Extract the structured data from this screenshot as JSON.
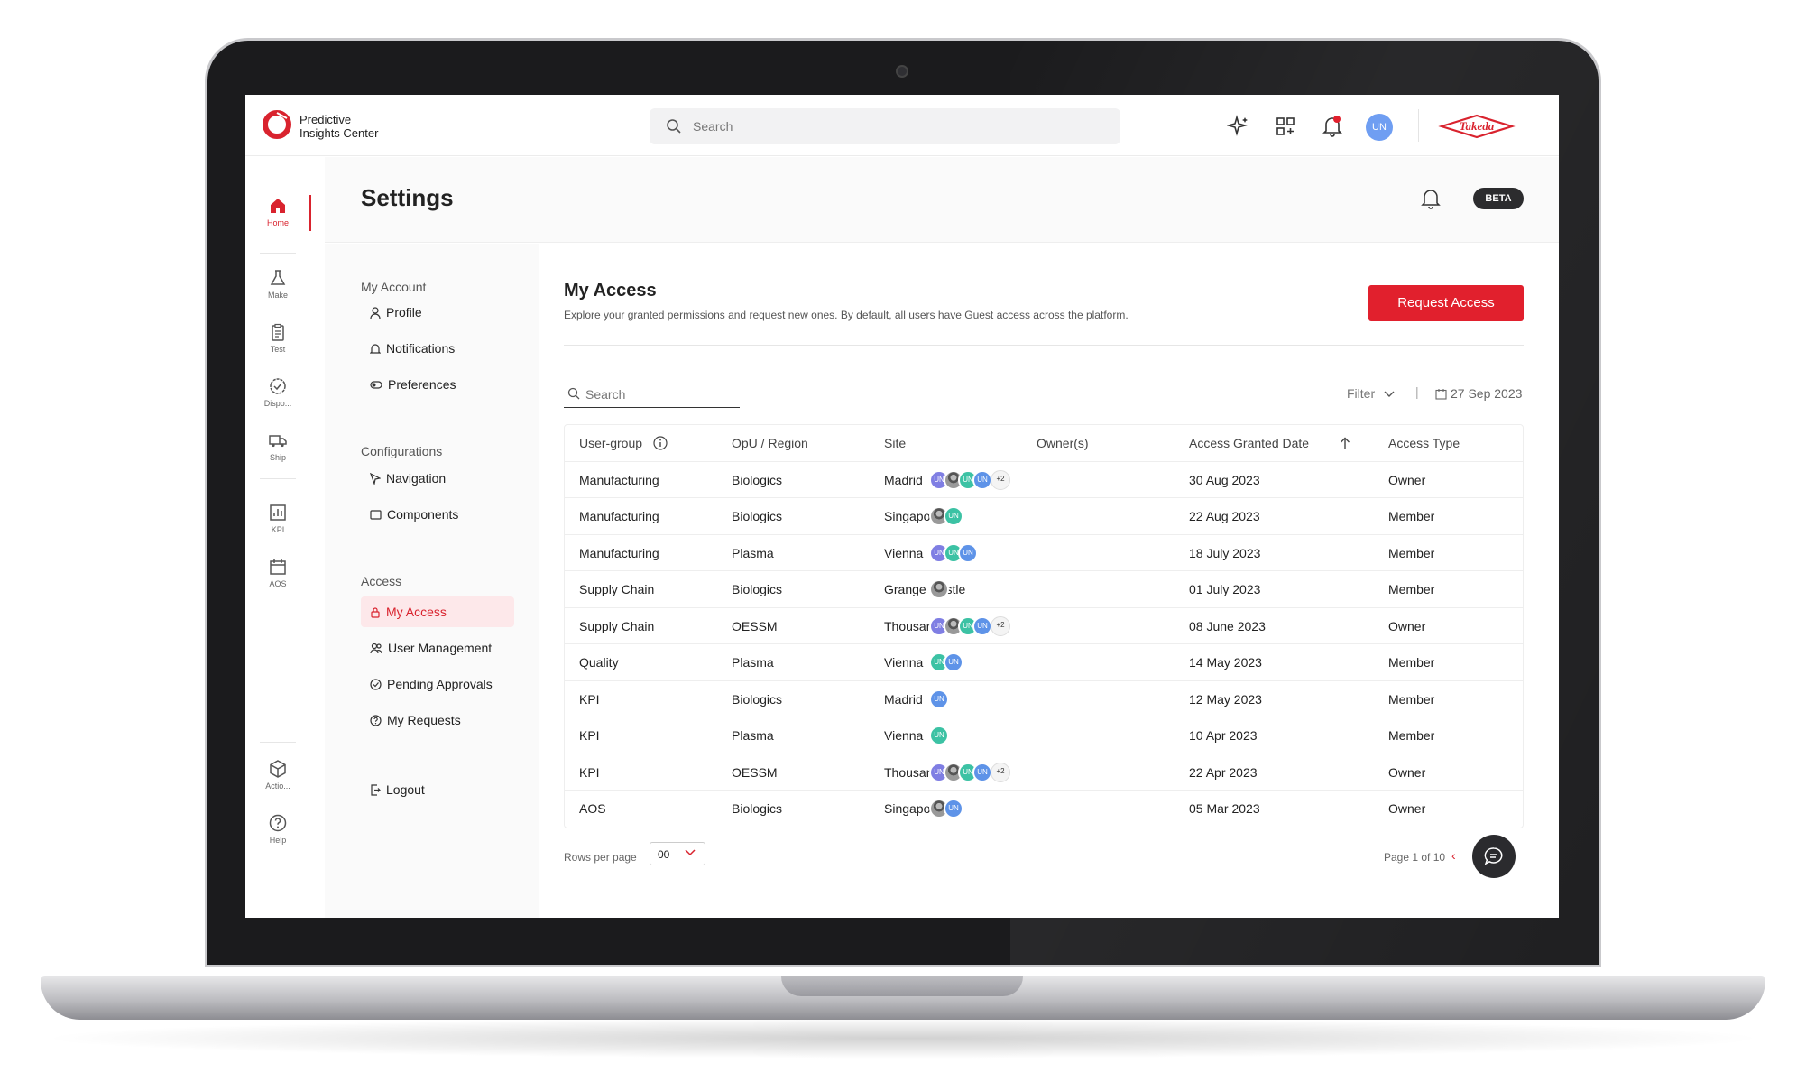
{
  "app": {
    "brand_line1": "Predictive",
    "brand_line2": "Insights Center",
    "search_placeholder": "Search",
    "avatar": "UN",
    "partner_logo": "Takeda"
  },
  "rail": [
    {
      "label": "Home",
      "icon": "home-icon",
      "active": true
    },
    {
      "label": "Make",
      "icon": "flask-icon"
    },
    {
      "label": "Test",
      "icon": "clipboard-icon"
    },
    {
      "label": "Dispo...",
      "icon": "check-badge-icon"
    },
    {
      "label": "Ship",
      "icon": "truck-icon"
    },
    {
      "label": "KPI",
      "icon": "bar-chart-icon"
    },
    {
      "label": "AOS",
      "icon": "calendar-icon"
    },
    {
      "label": "Actio...",
      "icon": "cube-icon"
    },
    {
      "label": "Help",
      "icon": "help-icon"
    }
  ],
  "settings": {
    "title": "Settings",
    "badge": "BETA"
  },
  "nav": {
    "groups": {
      "account": "My Account",
      "config": "Configurations",
      "access": "Access"
    },
    "items": {
      "profile": "Profile",
      "notifications": "Notifications",
      "preferences": "Preferences",
      "navigation": "Navigation",
      "components": "Components",
      "my_access": "My Access",
      "user_management": "User Management",
      "pending": "Pending Approvals",
      "my_requests": "My Requests",
      "logout": "Logout"
    }
  },
  "main": {
    "title": "My Access",
    "subtitle": "Explore your granted permissions and request new ones. By default, all users have Guest access across the platform.",
    "request_button": "Request Access",
    "search_placeholder": "Search",
    "filter": "Filter",
    "date": "27 Sep 2023"
  },
  "table": {
    "headers": {
      "group": "User-group",
      "opu": "OpU / Region",
      "site": "Site",
      "owners": "Owner(s)",
      "date": "Access Granted Date",
      "type": "Access Type"
    },
    "rows": [
      {
        "group": "Manufacturing",
        "opu": "Biologics",
        "site": "Madrid",
        "owners": [
          "p",
          "ph",
          "t",
          "b"
        ],
        "more": "+2",
        "date": "30 Aug 2023",
        "type": "Owner"
      },
      {
        "group": "Manufacturing",
        "opu": "Biologics",
        "site": "Singapore",
        "owners": [
          "ph",
          "t"
        ],
        "more": "",
        "date": "22 Aug 2023",
        "type": "Member"
      },
      {
        "group": "Manufacturing",
        "opu": "Plasma",
        "site": "Vienna",
        "owners": [
          "p",
          "t",
          "b"
        ],
        "more": "",
        "date": "18 July 2023",
        "type": "Member"
      },
      {
        "group": "Supply Chain",
        "opu": "Biologics",
        "site": "Grange Castle",
        "owners": [
          "ph"
        ],
        "more": "",
        "date": "01 July 2023",
        "type": "Member"
      },
      {
        "group": "Supply Chain",
        "opu": "OESSM",
        "site": "Thousand Oaks",
        "owners": [
          "p",
          "ph",
          "t",
          "b"
        ],
        "more": "+2",
        "date": "08 June 2023",
        "type": "Owner"
      },
      {
        "group": "Quality",
        "opu": "Plasma",
        "site": "Vienna",
        "owners": [
          "t",
          "b"
        ],
        "more": "",
        "date": "14 May 2023",
        "type": "Member"
      },
      {
        "group": "KPI",
        "opu": "Biologics",
        "site": "Madrid",
        "owners": [
          "b"
        ],
        "more": "",
        "date": "12 May 2023",
        "type": "Member"
      },
      {
        "group": "KPI",
        "opu": "Plasma",
        "site": "Vienna",
        "owners": [
          "t"
        ],
        "more": "",
        "date": "10 Apr 2023",
        "type": "Member"
      },
      {
        "group": "KPI",
        "opu": "OESSM",
        "site": "Thousand Oaks",
        "owners": [
          "p",
          "ph",
          "t",
          "b"
        ],
        "more": "+2",
        "date": "22 Apr 2023",
        "type": "Owner"
      },
      {
        "group": "AOS",
        "opu": "Biologics",
        "site": "Singapore",
        "owners": [
          "ph",
          "b"
        ],
        "more": "",
        "date": "05 Mar 2023",
        "type": "Owner"
      }
    ],
    "avatar_label": "UN"
  },
  "pagination": {
    "rows_label": "Rows per page",
    "rows_value": "00",
    "page_text": "Page 1 of 10"
  },
  "colors": {
    "accent": "#e1202d",
    "purple": "#7f7ee3",
    "teal": "#3cc2a4",
    "blue": "#5e93e8"
  }
}
